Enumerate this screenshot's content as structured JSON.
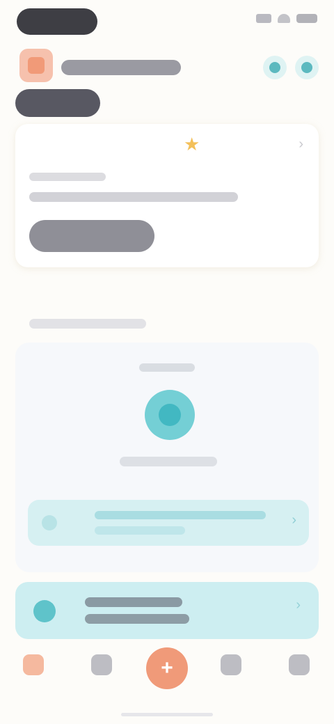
{
  "status_bar": {
    "time": ""
  },
  "header": {
    "brand": "",
    "icons": [
      "notification-icon",
      "settings-icon"
    ]
  },
  "tabs": [
    {
      "label": ""
    },
    {
      "label": ""
    },
    {
      "label": ""
    },
    {
      "label": ""
    }
  ],
  "card1": {
    "label": "",
    "star": "★",
    "chevron": "›",
    "button": ""
  },
  "section": {
    "title": ""
  },
  "card2": {
    "chevron": "›"
  },
  "promo": {
    "chevron": "›"
  },
  "nav": {
    "items": [
      {
        "label": ""
      },
      {
        "label": ""
      },
      {
        "label": ""
      },
      {
        "label": ""
      }
    ],
    "center": "+"
  },
  "colors": {
    "accent": "#f09a79",
    "teal": "#5fc3ca",
    "pill": "#585862"
  }
}
